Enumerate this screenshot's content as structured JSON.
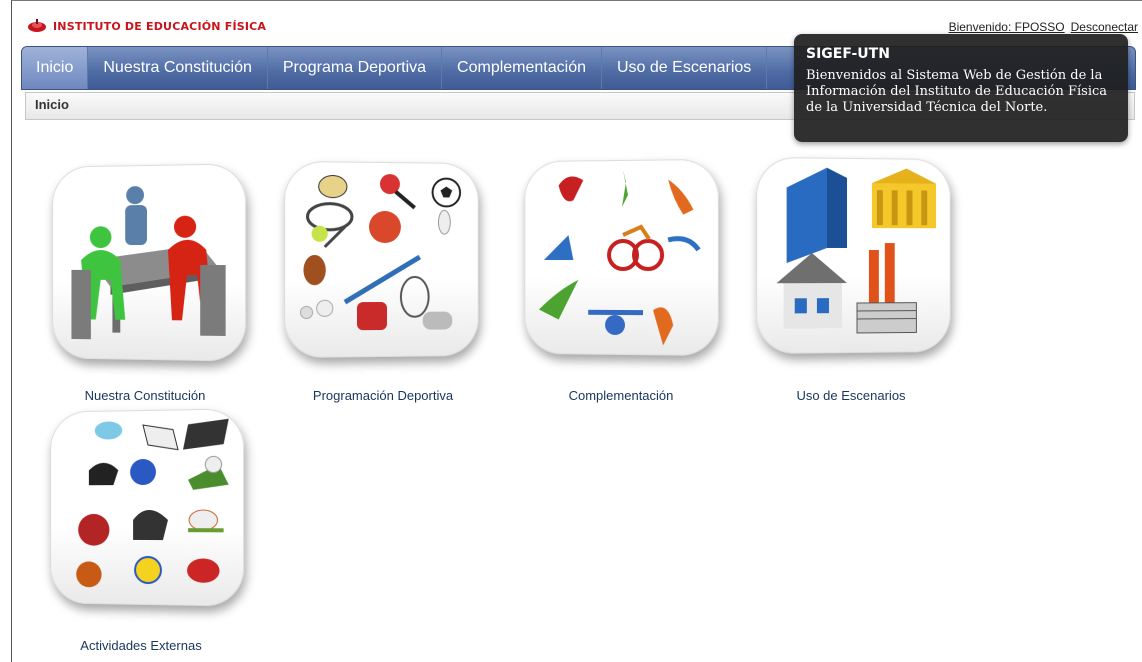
{
  "header": {
    "logo_text": "INSTITUTO DE EDUCACIÓN FÍSICA",
    "welcome": "Bienvenido: FPOSSO",
    "logout": "Desconectar"
  },
  "nav": {
    "items": [
      {
        "label": "Inicio",
        "active": true
      },
      {
        "label": "Nuestra Constitución"
      },
      {
        "label": "Programa Deportiva"
      },
      {
        "label": "Complementación"
      },
      {
        "label": "Uso de Escenarios"
      }
    ]
  },
  "breadcrumb": {
    "current": "Inicio"
  },
  "tooltip": {
    "title": "SIGEF-UTN",
    "body": "Bienvenidos al Sistema Web de Gestión de la Información del Instituto de Educación Física de la Universidad Técnica del Norte."
  },
  "tiles": [
    {
      "label": "Nuestra Constitución",
      "icon": "meeting-icon"
    },
    {
      "label": "Programación Deportiva",
      "icon": "sports-equipment-icon"
    },
    {
      "label": "Complementación",
      "icon": "athletes-icon"
    },
    {
      "label": "Uso de Escenarios",
      "icon": "buildings-icon"
    },
    {
      "label": "Actividades Externas",
      "icon": "sport-gear-icon"
    }
  ],
  "colors": {
    "nav": "#4e6ba4",
    "brand": "#c8141b",
    "caption": "#17365d"
  }
}
